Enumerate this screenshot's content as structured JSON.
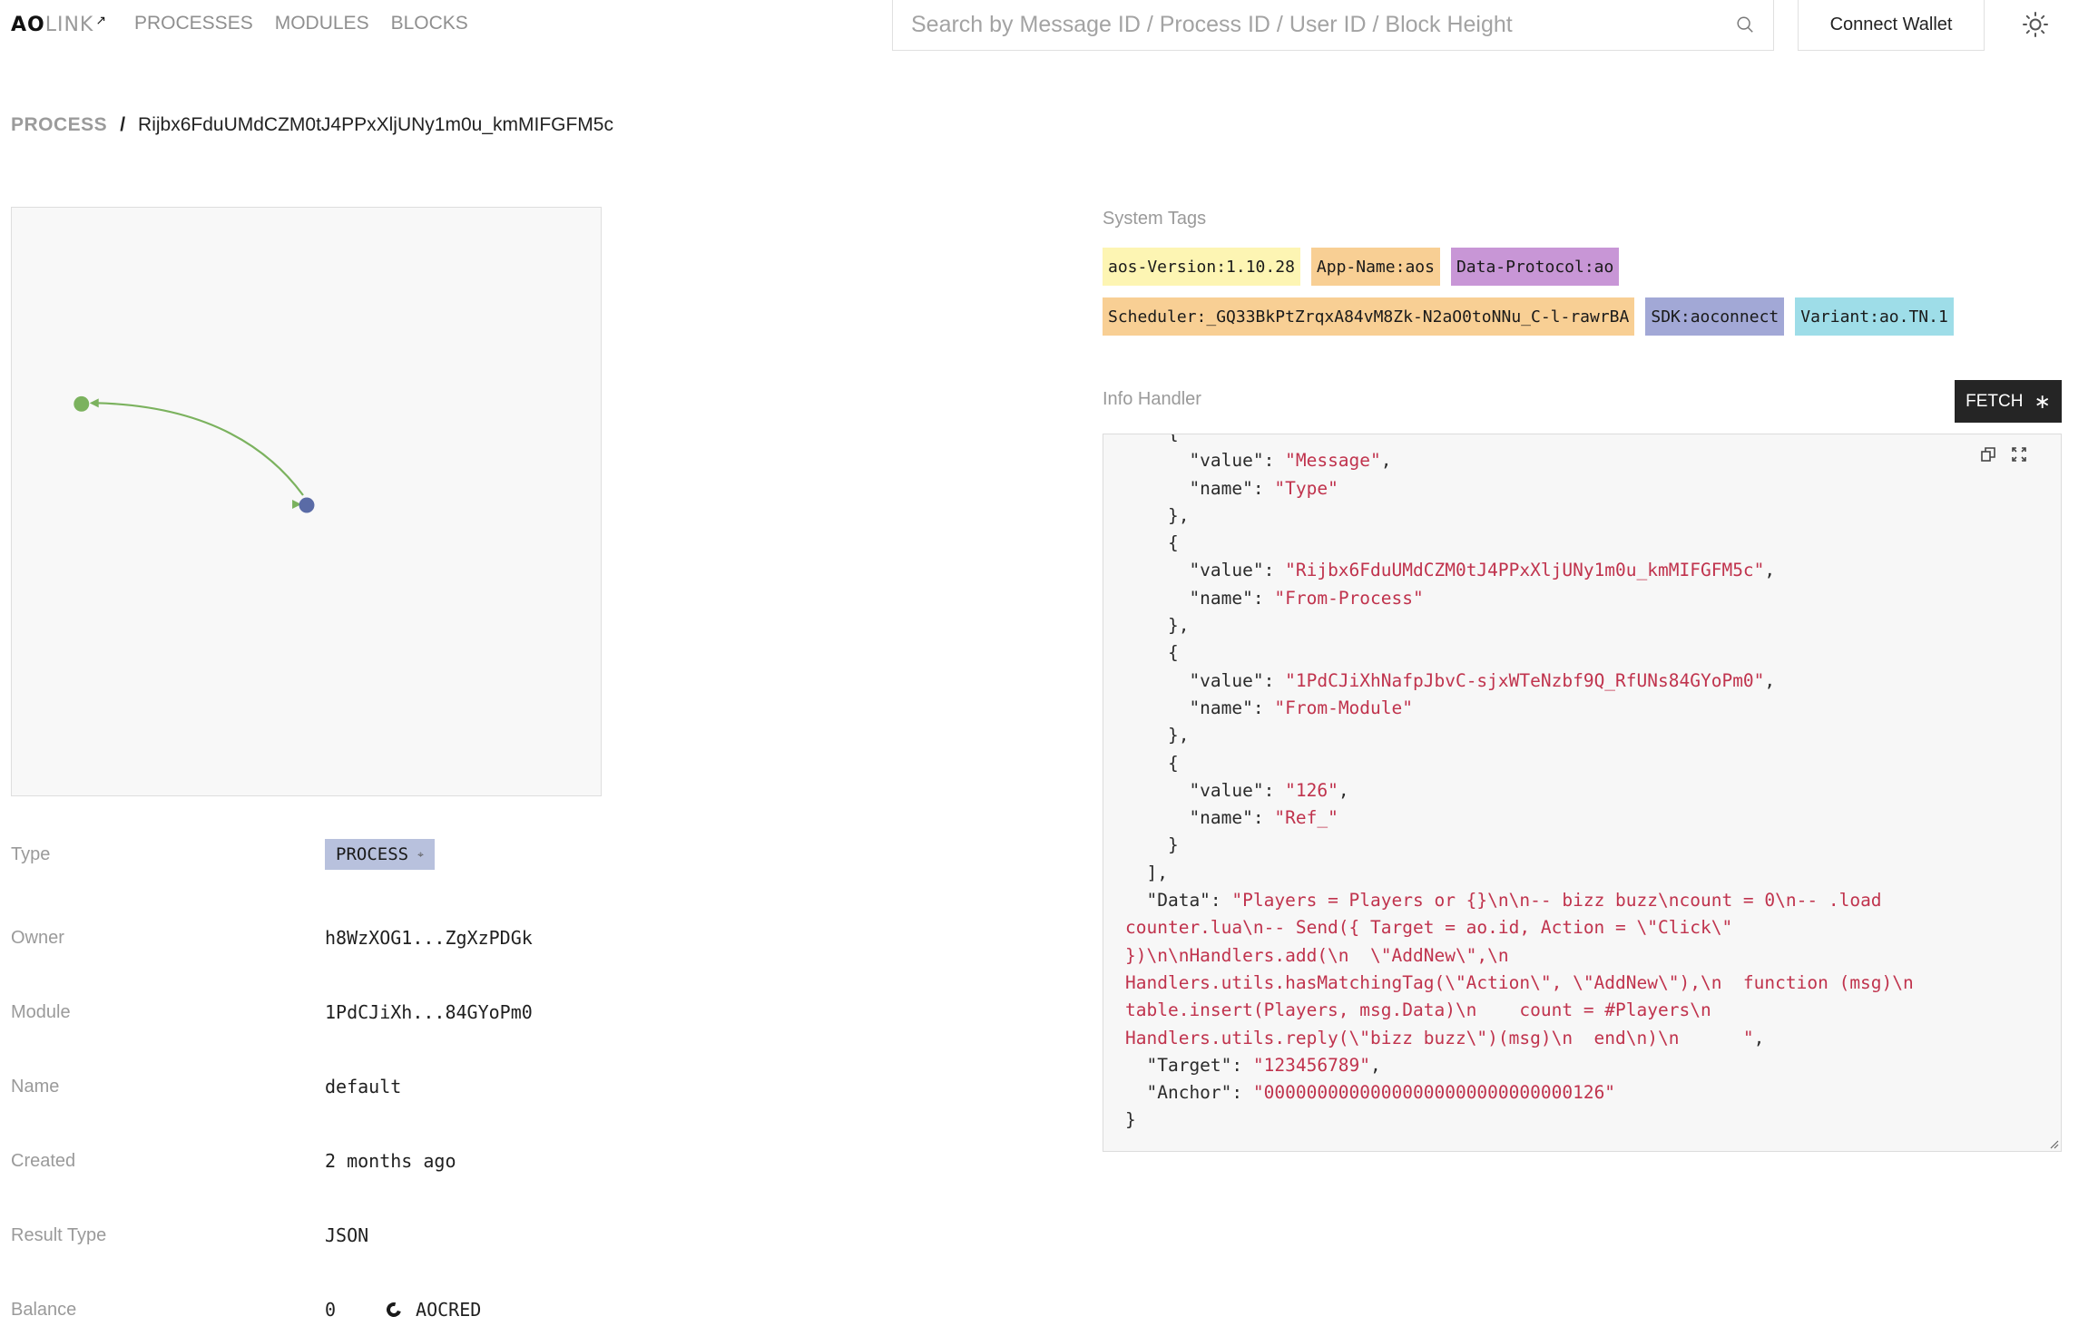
{
  "header": {
    "logo_ao": "AO",
    "logo_link": "LINK",
    "nav": [
      "PROCESSES",
      "MODULES",
      "BLOCKS"
    ],
    "search_placeholder": "Search by Message ID / Process ID / User ID / Block Height",
    "search_value": "",
    "connect_wallet": "Connect Wallet",
    "theme_icon": "sun-icon"
  },
  "breadcrumb": {
    "root": "PROCESS",
    "separator": "/",
    "id": "Rijbx6FduUMdCZM0tJ4PPxXljUNy1m0u_kmMIFGFM5c"
  },
  "graph": {
    "nodes": [
      {
        "id": "source",
        "role": "message-target",
        "color": "#7bb25e"
      },
      {
        "id": "process",
        "role": "current-process",
        "color": "#5a6ba6"
      }
    ],
    "edges": [
      {
        "from": "process",
        "to": "source",
        "color": "#7bb25e"
      }
    ]
  },
  "details": {
    "rows": [
      {
        "label": "Type",
        "value": "PROCESS"
      },
      {
        "label": "Owner",
        "value": "h8WzXOG1...ZgXzPDGk"
      },
      {
        "label": "Module",
        "value": "1PdCJiXh...84GYoPm0"
      },
      {
        "label": "Name",
        "value": "default"
      },
      {
        "label": "Created",
        "value": "2 months ago"
      },
      {
        "label": "Result Type",
        "value": "JSON"
      },
      {
        "label": "Balance",
        "value": "0",
        "token": "AOCRED"
      }
    ]
  },
  "system_tags": {
    "label": "System Tags",
    "tags": [
      {
        "text": "aos-Version:1.10.28",
        "color": "#fdf5b3"
      },
      {
        "text": "App-Name:aos",
        "color": "#f8cf94"
      },
      {
        "text": "Data-Protocol:ao",
        "color": "#c896d6"
      },
      {
        "text": "Scheduler:_GQ33BkPtZrqxA84vM8Zk-N2aO0toNNu_C-l-rawrBA",
        "color": "#f8cf94"
      },
      {
        "text": "SDK:aoconnect",
        "color": "#a2a8d6"
      },
      {
        "text": "Variant:ao.TN.1",
        "color": "#9edde8"
      }
    ]
  },
  "info_handler": {
    "label": "Info Handler",
    "fetch_label": "FETCH",
    "code_lines": [
      [
        {
          "t": "    {"
        }
      ],
      [
        {
          "t": "      \"value\": "
        },
        {
          "s": "\"Message\""
        },
        {
          "t": ","
        }
      ],
      [
        {
          "t": "      \"name\": "
        },
        {
          "s": "\"Type\""
        }
      ],
      [
        {
          "t": "    },"
        }
      ],
      [
        {
          "t": "    {"
        }
      ],
      [
        {
          "t": "      \"value\": "
        },
        {
          "s": "\"Rijbx6FduUMdCZM0tJ4PPxXljUNy1m0u_kmMIFGFM5c\""
        },
        {
          "t": ","
        }
      ],
      [
        {
          "t": "      \"name\": "
        },
        {
          "s": "\"From-Process\""
        }
      ],
      [
        {
          "t": "    },"
        }
      ],
      [
        {
          "t": "    {"
        }
      ],
      [
        {
          "t": "      \"value\": "
        },
        {
          "s": "\"1PdCJiXhNafpJbvC-sjxWTeNzbf9Q_RfUNs84GYoPm0\""
        },
        {
          "t": ","
        }
      ],
      [
        {
          "t": "      \"name\": "
        },
        {
          "s": "\"From-Module\""
        }
      ],
      [
        {
          "t": "    },"
        }
      ],
      [
        {
          "t": "    {"
        }
      ],
      [
        {
          "t": "      \"value\": "
        },
        {
          "s": "\"126\""
        },
        {
          "t": ","
        }
      ],
      [
        {
          "t": "      \"name\": "
        },
        {
          "s": "\"Ref_\""
        }
      ],
      [
        {
          "t": "    }"
        }
      ],
      [
        {
          "t": "  ],"
        }
      ],
      [
        {
          "t": "  \"Data\": "
        },
        {
          "s": "\"Players = Players or {}\\n\\n-- bizz buzz\\ncount = 0\\n-- .load"
        }
      ],
      [
        {
          "s": "counter.lua\\n-- Send({ Target = ao.id, Action = \\\"Click\\\""
        }
      ],
      [
        {
          "s": "})\\n\\nHandlers.add(\\n  \\\"AddNew\\\",\\n"
        }
      ],
      [
        {
          "s": "Handlers.utils.hasMatchingTag(\\\"Action\\\", \\\"AddNew\\\"),\\n  function (msg)\\n"
        }
      ],
      [
        {
          "s": "table.insert(Players, msg.Data)\\n    count = #Players\\n"
        }
      ],
      [
        {
          "s": "Handlers.utils.reply(\\\"bizz buzz\\\")(msg)\\n  end\\n)\\n      \""
        },
        {
          "t": ","
        }
      ],
      [
        {
          "t": "  \"Target\": "
        },
        {
          "s": "\"123456789\""
        },
        {
          "t": ","
        }
      ],
      [
        {
          "t": "  \"Anchor\": "
        },
        {
          "s": "\"00000000000000000000000000000126\""
        }
      ],
      [
        {
          "t": "}"
        }
      ]
    ]
  }
}
